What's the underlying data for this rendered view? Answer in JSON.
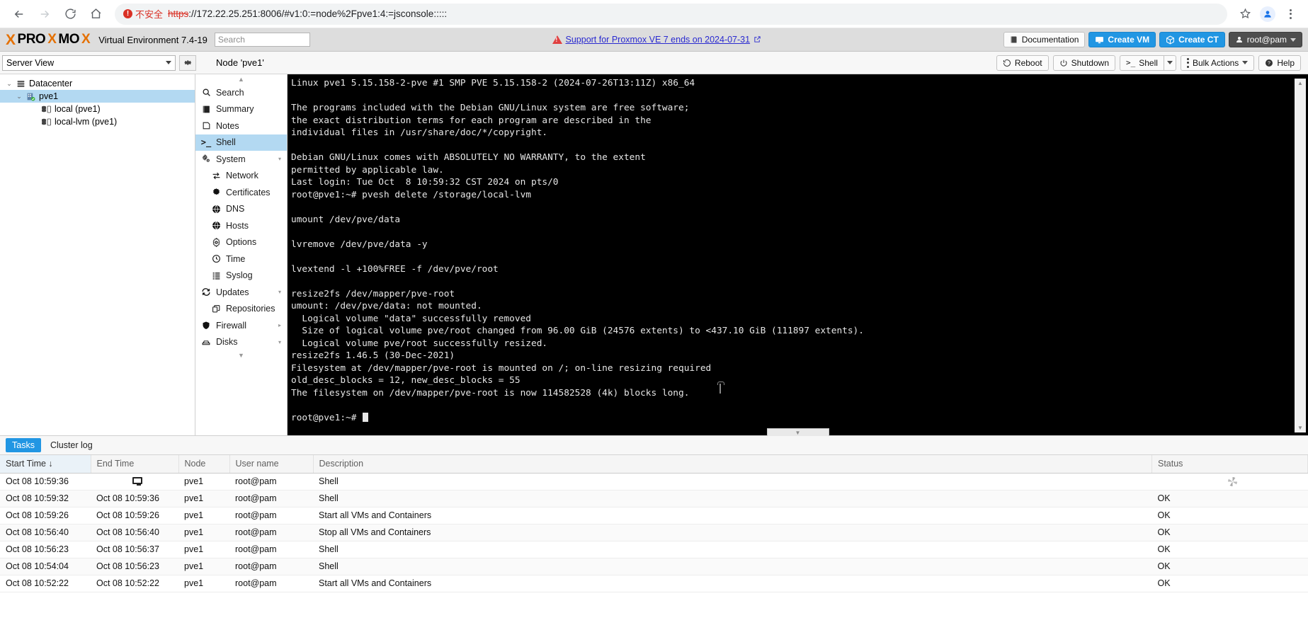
{
  "browser": {
    "back_icon": "back-arrow-icon",
    "forward_icon": "forward-arrow-icon",
    "reload_icon": "reload-icon",
    "home_icon": "home-icon",
    "insecure_label": "不安全",
    "url_scheme": "https",
    "url_rest": "://172.22.25.251:8006/#v1:0:=node%2Fpve1:4:=jsconsole:::::",
    "bookmark_icon": "star-icon",
    "profile_icon": "profile-avatar-icon",
    "menu_icon": "kebab-menu-icon"
  },
  "pve_header": {
    "logo_x": "X",
    "logo_part1": "PRO",
    "logo_part2": "X",
    "logo_part3": "MO",
    "logo_part4": "X",
    "product": "Virtual Environment 7.4-19",
    "search_placeholder": "Search",
    "search_value": "",
    "support_text": "Support for Proxmox VE 7 ends on 2024-07-31",
    "external_link_icon": "external-link-icon",
    "warning_icon": "warning-triangle-icon",
    "documentation": "Documentation",
    "create_vm": "Create VM",
    "create_ct": "Create CT",
    "user": "root@pam",
    "accent_blue": "#2196e3",
    "brand_orange": "#e57000"
  },
  "second_bar": {
    "view_select": "Server View",
    "gear_icon": "gear-icon",
    "node_title": "Node 'pve1'",
    "buttons": {
      "reboot": "Reboot",
      "shutdown": "Shutdown",
      "shell": "Shell",
      "bulk_actions": "Bulk Actions",
      "help": "Help"
    }
  },
  "tree": {
    "items": [
      {
        "label": "Datacenter",
        "level": 1,
        "icon": "datacenter-icon",
        "selected": false,
        "twisty": "⌄"
      },
      {
        "label": "pve1",
        "level": 2,
        "icon": "node-icon",
        "selected": true,
        "twisty": "⌄"
      },
      {
        "label": "local (pve1)",
        "level": 3,
        "icon": "storage-icon",
        "selected": false,
        "twisty": ""
      },
      {
        "label": "local-lvm (pve1)",
        "level": 3,
        "icon": "storage-icon",
        "selected": false,
        "twisty": ""
      }
    ]
  },
  "nav": {
    "items": [
      {
        "label": "Search",
        "icon": "search-icon",
        "sub": false,
        "active": false,
        "expander": ""
      },
      {
        "label": "Summary",
        "icon": "summary-icon",
        "sub": false,
        "active": false,
        "expander": ""
      },
      {
        "label": "Notes",
        "icon": "notes-icon",
        "sub": false,
        "active": false,
        "expander": ""
      },
      {
        "label": "Shell",
        "icon": "shell-icon",
        "sub": false,
        "active": true,
        "expander": ""
      },
      {
        "label": "System",
        "icon": "system-gear-icon",
        "sub": false,
        "active": false,
        "expander": "▾"
      },
      {
        "label": "Network",
        "icon": "network-icon",
        "sub": true,
        "active": false,
        "expander": ""
      },
      {
        "label": "Certificates",
        "icon": "certificate-icon",
        "sub": true,
        "active": false,
        "expander": ""
      },
      {
        "label": "DNS",
        "icon": "globe-icon",
        "sub": true,
        "active": false,
        "expander": ""
      },
      {
        "label": "Hosts",
        "icon": "globe-icon",
        "sub": true,
        "active": false,
        "expander": ""
      },
      {
        "label": "Options",
        "icon": "options-gear-icon",
        "sub": true,
        "active": false,
        "expander": ""
      },
      {
        "label": "Time",
        "icon": "clock-icon",
        "sub": true,
        "active": false,
        "expander": ""
      },
      {
        "label": "Syslog",
        "icon": "syslog-icon",
        "sub": true,
        "active": false,
        "expander": ""
      },
      {
        "label": "Updates",
        "icon": "refresh-icon",
        "sub": false,
        "active": false,
        "expander": "▾"
      },
      {
        "label": "Repositories",
        "icon": "repositories-icon",
        "sub": true,
        "active": false,
        "expander": ""
      },
      {
        "label": "Firewall",
        "icon": "shield-icon",
        "sub": false,
        "active": false,
        "expander": "▸"
      },
      {
        "label": "Disks",
        "icon": "disk-icon",
        "sub": false,
        "active": false,
        "expander": "▾"
      }
    ],
    "scroll_up_icon": "chevron-up-icon",
    "scroll_down_icon": "chevron-down-icon"
  },
  "terminal": {
    "lines": [
      "Linux pve1 5.15.158-2-pve #1 SMP PVE 5.15.158-2 (2024-07-26T13:11Z) x86_64",
      "",
      "The programs included with the Debian GNU/Linux system are free software;",
      "the exact distribution terms for each program are described in the",
      "individual files in /usr/share/doc/*/copyright.",
      "",
      "Debian GNU/Linux comes with ABSOLUTELY NO WARRANTY, to the extent",
      "permitted by applicable law.",
      "Last login: Tue Oct  8 10:59:32 CST 2024 on pts/0",
      "root@pve1:~# pvesh delete /storage/local-lvm",
      "",
      "umount /dev/pve/data",
      "",
      "lvremove /dev/pve/data -y",
      "",
      "lvextend -l +100%FREE -f /dev/pve/root",
      "",
      "resize2fs /dev/mapper/pve-root",
      "umount: /dev/pve/data: not mounted.",
      "  Logical volume \"data\" successfully removed",
      "  Size of logical volume pve/root changed from 96.00 GiB (24576 extents) to <437.10 GiB (111897 extents).",
      "  Logical volume pve/root successfully resized.",
      "resize2fs 1.46.5 (30-Dec-2021)",
      "Filesystem at /dev/mapper/pve-root is mounted on /; on-line resizing required",
      "old_desc_blocks = 12, new_desc_blocks = 55",
      "The filesystem on /dev/mapper/pve-root is now 114582528 (4k) blocks long.",
      ""
    ],
    "prompt": "root@pve1:~# "
  },
  "tasks": {
    "tabs": [
      {
        "label": "Tasks",
        "active": true
      },
      {
        "label": "Cluster log",
        "active": false
      }
    ],
    "columns": [
      "Start Time",
      "End Time",
      "Node",
      "User name",
      "Description",
      "Status"
    ],
    "sort_indicator": "↓",
    "rows": [
      {
        "start": "Oct 08 10:59:36",
        "end": "",
        "end_icon": "monitor-icon",
        "node": "pve1",
        "user": "root@pam",
        "desc": "Shell",
        "status": "",
        "status_icon": "loading-spinner-icon"
      },
      {
        "start": "Oct 08 10:59:32",
        "end": "Oct 08 10:59:36",
        "end_icon": "",
        "node": "pve1",
        "user": "root@pam",
        "desc": "Shell",
        "status": "OK",
        "status_icon": ""
      },
      {
        "start": "Oct 08 10:59:26",
        "end": "Oct 08 10:59:26",
        "end_icon": "",
        "node": "pve1",
        "user": "root@pam",
        "desc": "Start all VMs and Containers",
        "status": "OK",
        "status_icon": ""
      },
      {
        "start": "Oct 08 10:56:40",
        "end": "Oct 08 10:56:40",
        "end_icon": "",
        "node": "pve1",
        "user": "root@pam",
        "desc": "Stop all VMs and Containers",
        "status": "OK",
        "status_icon": ""
      },
      {
        "start": "Oct 08 10:56:23",
        "end": "Oct 08 10:56:37",
        "end_icon": "",
        "node": "pve1",
        "user": "root@pam",
        "desc": "Shell",
        "status": "OK",
        "status_icon": ""
      },
      {
        "start": "Oct 08 10:54:04",
        "end": "Oct 08 10:56:23",
        "end_icon": "",
        "node": "pve1",
        "user": "root@pam",
        "desc": "Shell",
        "status": "OK",
        "status_icon": ""
      },
      {
        "start": "Oct 08 10:52:22",
        "end": "Oct 08 10:52:22",
        "end_icon": "",
        "node": "pve1",
        "user": "root@pam",
        "desc": "Start all VMs and Containers",
        "status": "OK",
        "status_icon": ""
      }
    ]
  }
}
